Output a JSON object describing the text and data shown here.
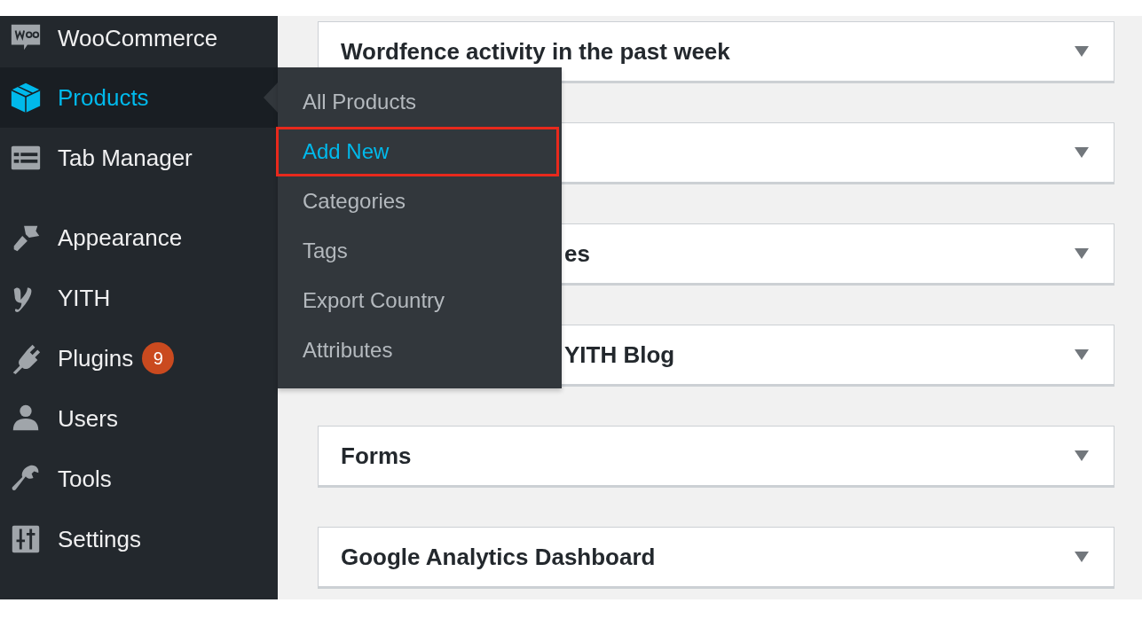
{
  "sidebar": {
    "items": [
      {
        "label": "WooCommerce",
        "selected": false
      },
      {
        "label": "Products",
        "selected": true
      },
      {
        "label": "Tab Manager",
        "selected": false
      },
      {
        "label": "Appearance",
        "selected": false
      },
      {
        "label": "YITH",
        "selected": false
      },
      {
        "label": "Plugins",
        "selected": false,
        "badge": "9"
      },
      {
        "label": "Users",
        "selected": false
      },
      {
        "label": "Tools",
        "selected": false
      },
      {
        "label": "Settings",
        "selected": false
      }
    ]
  },
  "submenu": {
    "items": [
      {
        "label": "All Products",
        "selected": false,
        "highlighted": false
      },
      {
        "label": "Add New",
        "selected": true,
        "highlighted": true
      },
      {
        "label": "Categories",
        "selected": false,
        "highlighted": false
      },
      {
        "label": "Tags",
        "selected": false,
        "highlighted": false
      },
      {
        "label": "Export Country",
        "selected": false,
        "highlighted": false
      },
      {
        "label": "Attributes",
        "selected": false,
        "highlighted": false
      }
    ]
  },
  "panels": [
    {
      "kind": "panel",
      "title": "Wordfence activity in the past week",
      "covered": false
    },
    {
      "kind": "panel"
    },
    {
      "kind": "panel",
      "title": "es",
      "covered": true
    },
    {
      "kind": "panel",
      "title": "YITH Blog",
      "covered": true
    },
    {
      "kind": "panel",
      "title": "Forms",
      "covered": false
    },
    {
      "kind": "panel",
      "title": "Google Analytics Dashboard",
      "covered": false
    }
  ]
}
